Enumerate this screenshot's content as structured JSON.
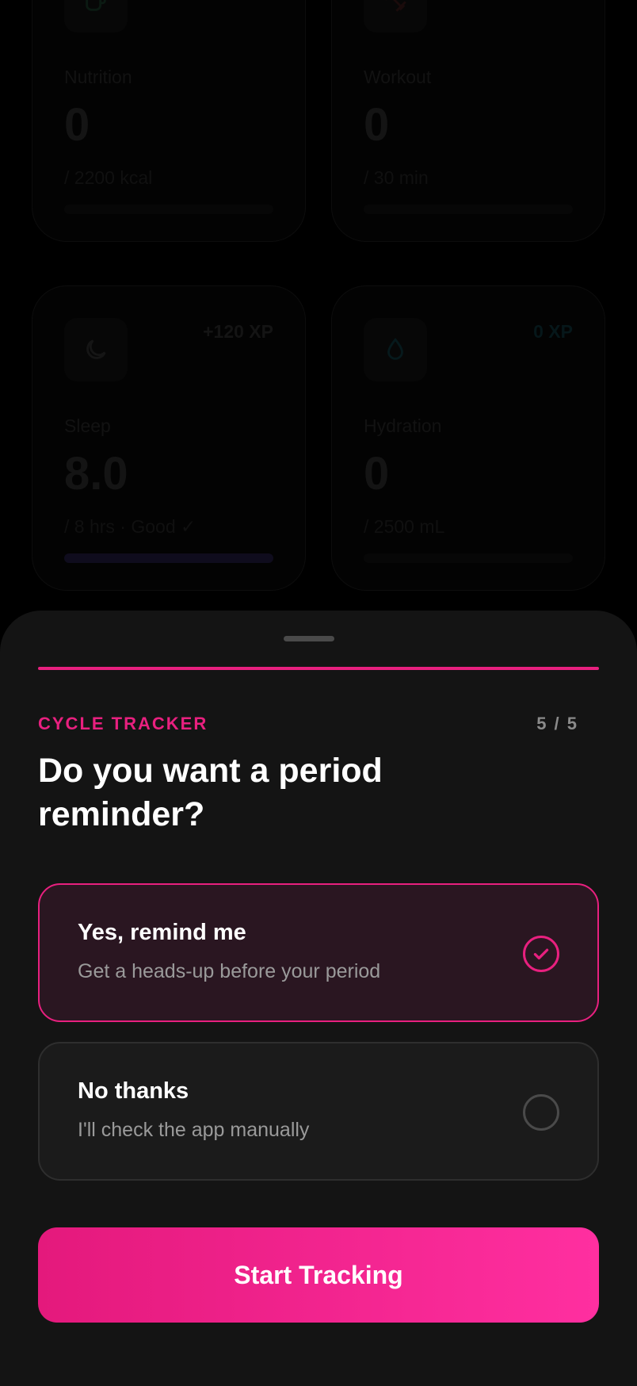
{
  "dashboard": {
    "cards": [
      {
        "label": "Nutrition",
        "value": "0",
        "sub": "/ 2200 kcal",
        "icon": "cup-icon",
        "progress": 0
      },
      {
        "label": "Workout",
        "value": "0",
        "sub": "/ 30 min",
        "icon": "dumbbell-icon",
        "progress": 0
      },
      {
        "label": "Sleep",
        "value": "8.0",
        "sub": "/ 8 hrs · Good ✓",
        "xp": "+120 XP",
        "icon": "moon-icon",
        "progress": 1.0
      },
      {
        "label": "Hydration",
        "value": "0",
        "sub": "/ 2500 mL",
        "xp": "0 XP",
        "icon": "droplet-icon",
        "progress": 0
      }
    ]
  },
  "sheet": {
    "kicker": "CYCLE TRACKER",
    "step": "5 / 5",
    "question": "Do you want a period reminder?",
    "options": [
      {
        "title": "Yes, remind me",
        "desc": "Get a heads-up before your period",
        "selected": true
      },
      {
        "title": "No thanks",
        "desc": "I'll check the app manually",
        "selected": false
      }
    ],
    "cta_label": "Start Tracking"
  },
  "colors": {
    "accent": "#e8207f",
    "sheet_bg": "#141414",
    "selected_bg": "#2a1621"
  }
}
